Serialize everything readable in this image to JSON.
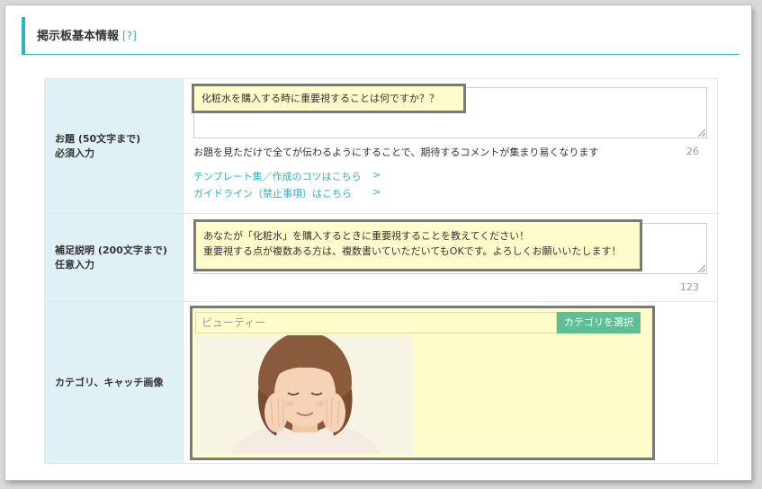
{
  "section": {
    "title": "掲示板基本情報",
    "help": "[?]"
  },
  "rows": {
    "topic": {
      "label_line1": "お題 (50文字まで)",
      "label_line2": "必須入力",
      "value": "化粧水を購入する時に重要視することは何ですか？？",
      "hint": "お題を見ただけで全てが伝わるようにすることで、期待するコメントが集まり易くなります",
      "count": "26",
      "link_templates": "テンプレート集／作成のコツはこちら",
      "link_guidelines": "ガイドライン（禁止事項）はこちら",
      "chevron": ">"
    },
    "description": {
      "label_line1": "補足説明 (200文字まで)",
      "label_line2": "任意入力",
      "value_line1": "あなたが「化粧水」を購入するときに重要視することを教えてください！",
      "value_line2": "重要視する点が複数ある方は、複数書いていただいてもOKです。よろしくお願いいたします！",
      "count": "123"
    },
    "category": {
      "label": "カテゴリ、キャッチ画像",
      "value": "ビューティー",
      "select_button": "カテゴリを選択"
    }
  },
  "colors": {
    "accent": "#2bb3c0",
    "highlight": "#fffccb",
    "button": "#5cc094",
    "label_bg": "#dff1f5"
  }
}
